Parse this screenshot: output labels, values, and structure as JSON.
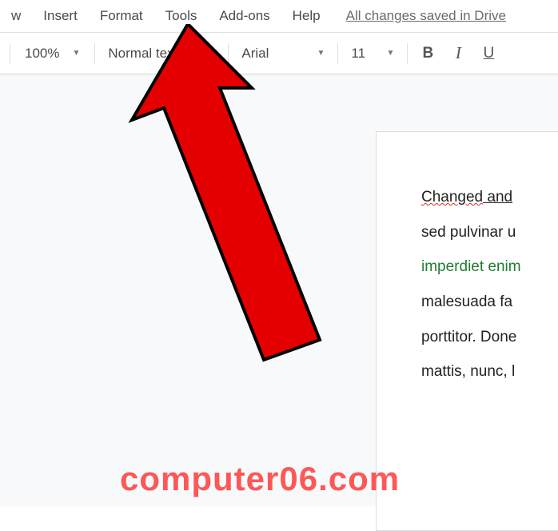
{
  "menubar": {
    "items": [
      {
        "label": "w"
      },
      {
        "label": "Insert"
      },
      {
        "label": "Format"
      },
      {
        "label": "Tools"
      },
      {
        "label": "Add-ons"
      },
      {
        "label": "Help"
      }
    ],
    "save_status": "All changes saved in Drive"
  },
  "toolbar": {
    "zoom": "100%",
    "paragraph_style": "Normal text",
    "font_family": "Arial",
    "font_size": "11",
    "bold": "B",
    "italic": "I",
    "underline": "U"
  },
  "document": {
    "line1_a": "Changed",
    "line1_b": " and",
    "line2": "sed pulvinar u",
    "line3": "imperdiet enim",
    "line4": "malesuada fa",
    "line5": "porttitor. Done",
    "line6": "mattis, nunc, l"
  },
  "annotation": {
    "arrow_color": "#e40000",
    "arrow_stroke": "#000000"
  },
  "watermark": "computer06.com"
}
